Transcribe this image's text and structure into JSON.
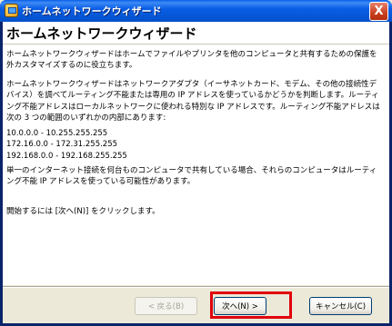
{
  "window": {
    "title": "ホームネットワークウィザード",
    "close_label": "X"
  },
  "heading": "ホームネットワークウィザード",
  "paragraphs": {
    "p1": "ホームネットワークウィザードはホームでファイルやプリンタを他のコンピュータと共有するための保護を外カスタマイズするのに役立ちます。",
    "p2": "ホームネットワークウィザードはネットワークアダプタ（イーサネットカード、モデム、その他の接続性デバイス）を調べてルーティング不能または専用の IP アドレスを使っているかどうかを判断します。ルーティング不能アドレスはローカルネットワークに使われる特別な IP アドレスです。ルーティング不能アドレスは次の 3 つの範囲のいずれかの内部にあります:",
    "ranges": [
      "10.0.0.0 - 10.255.255.255",
      "172.16.0.0 - 172.31.255.255",
      "192.168.0.0 - 192.168.255.255"
    ],
    "p3": "単一のインターネット接続を何台ものコンピュータで共有している場合、それらのコンピュータはルーティング不能 IP アドレスを使っている可能性があります。",
    "p4": "開始するには [次へ(N)] をクリックします。"
  },
  "buttons": {
    "back": "< 戻る(B)",
    "next": "次へ(N) >",
    "cancel": "キャンセル(C)"
  },
  "colors": {
    "titlebar": "#0a5ee6",
    "highlight": "#e0000b"
  }
}
